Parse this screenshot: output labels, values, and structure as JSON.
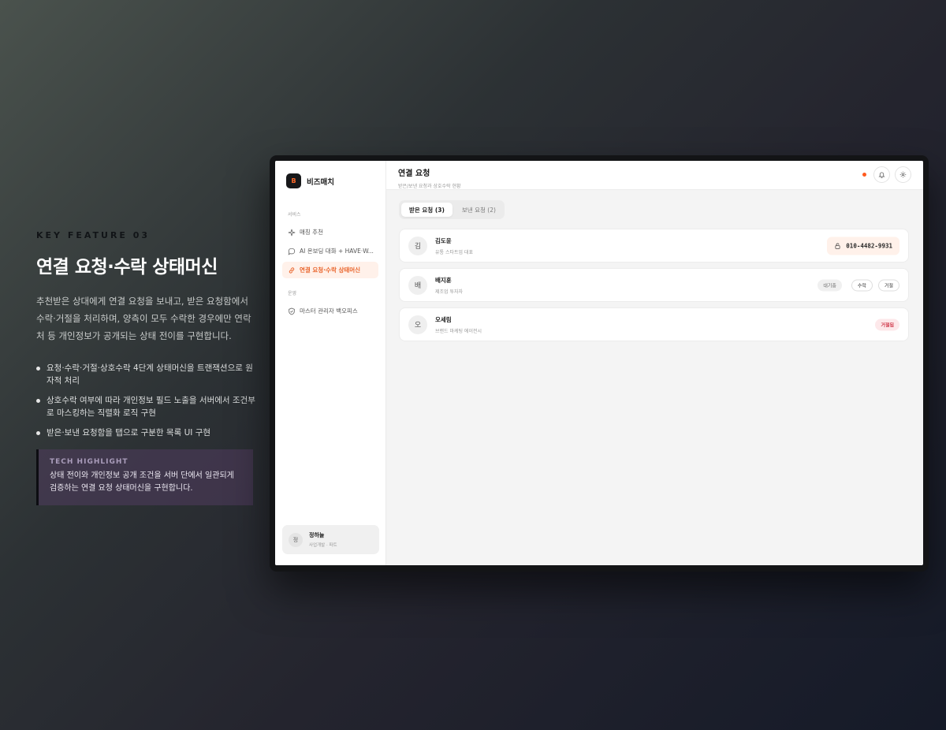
{
  "feature": {
    "eyebrow": "KEY FEATURE 03",
    "title": "연결 요청·수락 상태머신",
    "description": "추천받은 상대에게 연결 요청을 보내고, 받은 요청함에서 수락·거절을 처리하며, 양측이 모두 수락한 경우에만 연락처 등 개인정보가 공개되는 상태 전이를 구현합니다.",
    "bullets": [
      "요청·수락·거절·상호수락 4단계 상태머신을 트랜잭션으로 원자적 처리",
      "상호수락 여부에 따라 개인정보 필드 노출을 서버에서 조건부로 마스킹하는 직렬화 로직 구현",
      "받은·보낸 요청함을 탭으로 구분한 목록 UI 구현"
    ],
    "highlight": {
      "label": "TECH HIGHLIGHT",
      "text": "상태 전이와 개인정보 공개 조건을 서버 단에서 일관되게 검증하는 연결 요청 상태머신을 구현합니다."
    }
  },
  "app": {
    "brand": {
      "logo": "B",
      "name": "비즈매치"
    },
    "sidebar": {
      "section_service": "서비스",
      "section_ops": "운영",
      "items": [
        {
          "label": "매칭 추천",
          "icon": "sparkle-icon"
        },
        {
          "label": "AI 온보딩 대화 + HAVE·W...",
          "icon": "chat-bubble-icon"
        },
        {
          "label": "연결 요청·수락 상태머신",
          "icon": "link-icon",
          "active": true
        },
        {
          "label": "마스터 관리자 백오피스",
          "icon": "shield-icon"
        }
      ],
      "user": {
        "initial": "정",
        "name": "정하늘",
        "role": "사업개발 · 파트"
      }
    },
    "header": {
      "title": "연결 요청",
      "subtitle": "받은/보낸 요청과 상호수락 현황"
    },
    "tabs": [
      {
        "label": "받은 요청 (3)",
        "active": true
      },
      {
        "label": "보낸 요청 (2)",
        "active": false
      }
    ],
    "requests": [
      {
        "initial": "김",
        "name": "김도윤",
        "role": "유통 스타트업 대표",
        "phone": "010-4482-9931",
        "status": "mutual"
      },
      {
        "initial": "배",
        "name": "배지훈",
        "role": "제조업 투자자",
        "status_label": "대기중",
        "accept": "수락",
        "reject": "거절"
      },
      {
        "initial": "오",
        "name": "오세림",
        "role": "브랜드 마케팅 에이전시",
        "status_label": "거절됨"
      }
    ],
    "colors": {
      "accent": "#e9632a",
      "notification": "#ff5a1f",
      "rejected": "#d0384a"
    }
  }
}
